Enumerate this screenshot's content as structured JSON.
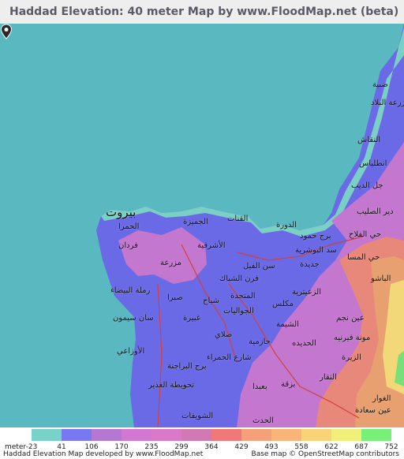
{
  "title": "Haddad Elevation: 40 meter Map by www.FloodMap.net (beta)",
  "places": [
    {
      "name": "بيروت",
      "big": true
    },
    {
      "name": "فردان"
    },
    {
      "name": "الحمرا"
    },
    {
      "name": "رملة البيضاء"
    },
    {
      "name": "مزرعة"
    },
    {
      "name": "صبرا"
    },
    {
      "name": "سان سيمون"
    },
    {
      "name": "الأوزاعي"
    },
    {
      "name": "غبيرة"
    },
    {
      "name": "برج البراجنة"
    },
    {
      "name": "تحويطة الغدير"
    },
    {
      "name": "الشويفات"
    },
    {
      "name": "الجميزة"
    },
    {
      "name": "الأشرفية"
    },
    {
      "name": "القنات"
    },
    {
      "name": "الدورة"
    },
    {
      "name": "سن الفيل"
    },
    {
      "name": "فرن الشباك"
    },
    {
      "name": "شياح"
    },
    {
      "name": "الجواليات"
    },
    {
      "name": "المتحدة"
    },
    {
      "name": "صلاي"
    },
    {
      "name": "شارع الحمراء"
    },
    {
      "name": "حازمية"
    },
    {
      "name": "بعبدا"
    },
    {
      "name": "بزقة"
    },
    {
      "name": "الحدث"
    },
    {
      "name": "برج حمود"
    },
    {
      "name": "سد البوشرية"
    },
    {
      "name": "جديدة"
    },
    {
      "name": "الزعيترية"
    },
    {
      "name": "مكلس"
    },
    {
      "name": "الشيمة"
    },
    {
      "name": "الحديده"
    },
    {
      "name": "عين نجم"
    },
    {
      "name": "مونة فيرنيه"
    },
    {
      "name": "الزيرة"
    },
    {
      "name": "النقار"
    },
    {
      "name": "حي الفلاح"
    },
    {
      "name": "النقاش"
    },
    {
      "name": "انطلياس"
    },
    {
      "name": "ضبية"
    },
    {
      "name": "جل الديب"
    },
    {
      "name": "دير الصليب"
    },
    {
      "name": "الباشو"
    },
    {
      "name": "مزرعة البلاد"
    },
    {
      "name": "عين سعادة"
    },
    {
      "name": "الغوار"
    },
    {
      "name": "حي المسا"
    }
  ],
  "legend": {
    "unit": "meter",
    "items": [
      {
        "value": "-23",
        "color": "#78d2c8"
      },
      {
        "value": "41",
        "color": "#7878f0"
      },
      {
        "value": "106",
        "color": "#b478d2"
      },
      {
        "value": "170",
        "color": "#d278d2"
      },
      {
        "value": "235",
        "color": "#dc78c8"
      },
      {
        "value": "299",
        "color": "#d278b4"
      },
      {
        "value": "364",
        "color": "#f07878"
      },
      {
        "value": "429",
        "color": "#f5a078"
      },
      {
        "value": "493",
        "color": "#fab478"
      },
      {
        "value": "558",
        "color": "#fad278"
      },
      {
        "value": "622",
        "color": "#f0f078"
      },
      {
        "value": "687",
        "color": "#78f078"
      },
      {
        "value": "752",
        "color": ""
      }
    ]
  },
  "credits": {
    "left": "Haddad Elevation Map developed by www.FloodMap.net",
    "right": "Base map © OpenStreetMap contributors"
  },
  "colors": {
    "sea": "#5ab8c0",
    "lowland": "#6a6ae6",
    "mid": "#c477cf",
    "high": "#e8a070",
    "peak": "#f2d878",
    "shore": "#7ad0c4"
  }
}
